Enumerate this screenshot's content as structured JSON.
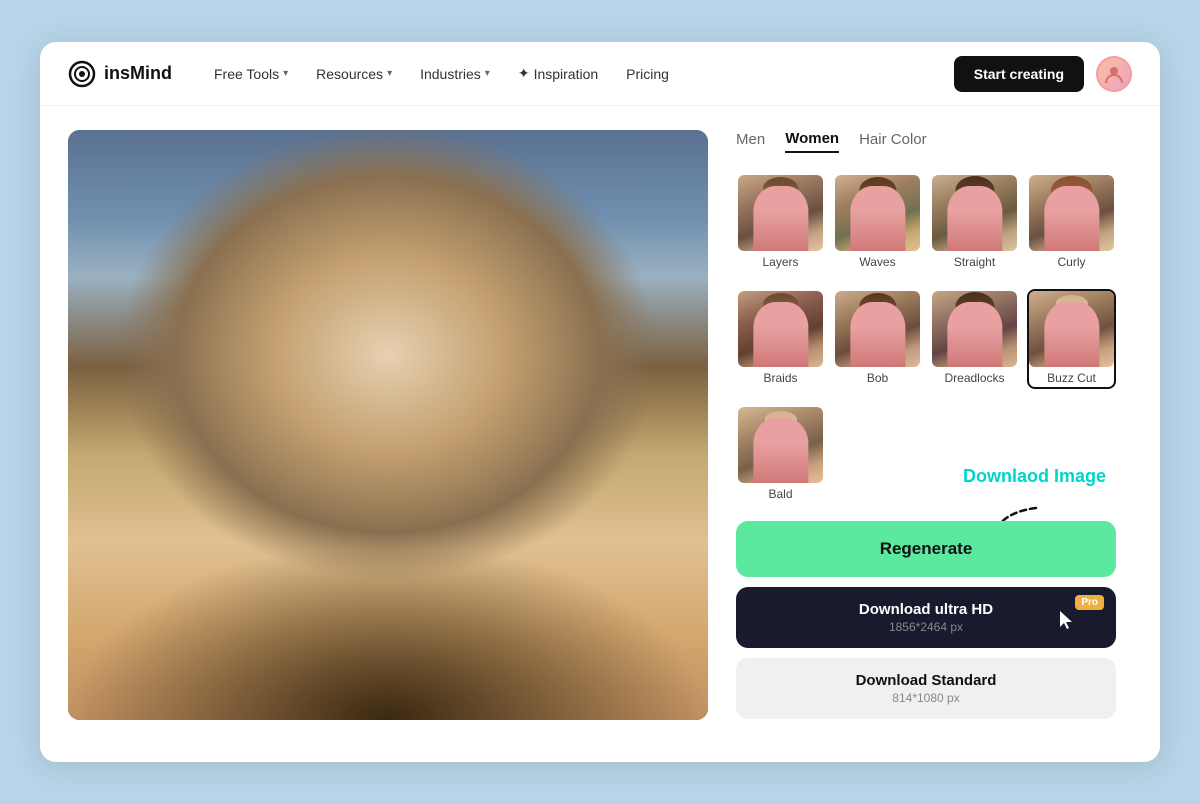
{
  "brand": {
    "name": "insMind",
    "logo_aria": "insMind logo"
  },
  "nav": {
    "items": [
      {
        "id": "free-tools",
        "label": "Free Tools",
        "has_dropdown": true
      },
      {
        "id": "resources",
        "label": "Resources",
        "has_dropdown": true
      },
      {
        "id": "industries",
        "label": "Industries",
        "has_dropdown": true
      },
      {
        "id": "inspiration",
        "label": "Inspiration",
        "has_dropdown": false,
        "has_spark": true
      },
      {
        "id": "pricing",
        "label": "Pricing",
        "has_dropdown": false
      }
    ],
    "start_creating": "Start creating"
  },
  "tabs": [
    {
      "id": "men",
      "label": "Men",
      "active": false
    },
    {
      "id": "women",
      "label": "Women",
      "active": true
    },
    {
      "id": "hair-color",
      "label": "Hair Color",
      "active": false
    }
  ],
  "hairstyles": {
    "row1": [
      {
        "id": "layers",
        "label": "Layers",
        "selected": false
      },
      {
        "id": "waves",
        "label": "Waves",
        "selected": false
      },
      {
        "id": "straight",
        "label": "Straight",
        "selected": false
      },
      {
        "id": "curly",
        "label": "Curly",
        "selected": false
      }
    ],
    "row2": [
      {
        "id": "braids",
        "label": "Braids",
        "selected": false
      },
      {
        "id": "bob",
        "label": "Bob",
        "selected": false
      },
      {
        "id": "dreadlocks",
        "label": "Dreadlocks",
        "selected": false
      },
      {
        "id": "buzz-cut",
        "label": "Buzz Cut",
        "selected": true
      }
    ],
    "row3": [
      {
        "id": "bald",
        "label": "Bald",
        "selected": false
      }
    ]
  },
  "buttons": {
    "regenerate": "Regenerate",
    "download_hd": "Download ultra HD",
    "download_hd_size": "1856*2464 px",
    "download_hd_pro": "Pro",
    "download_std": "Download Standard",
    "download_std_size": "814*1080 px"
  },
  "annotation": {
    "text": "Downlaod Image"
  }
}
